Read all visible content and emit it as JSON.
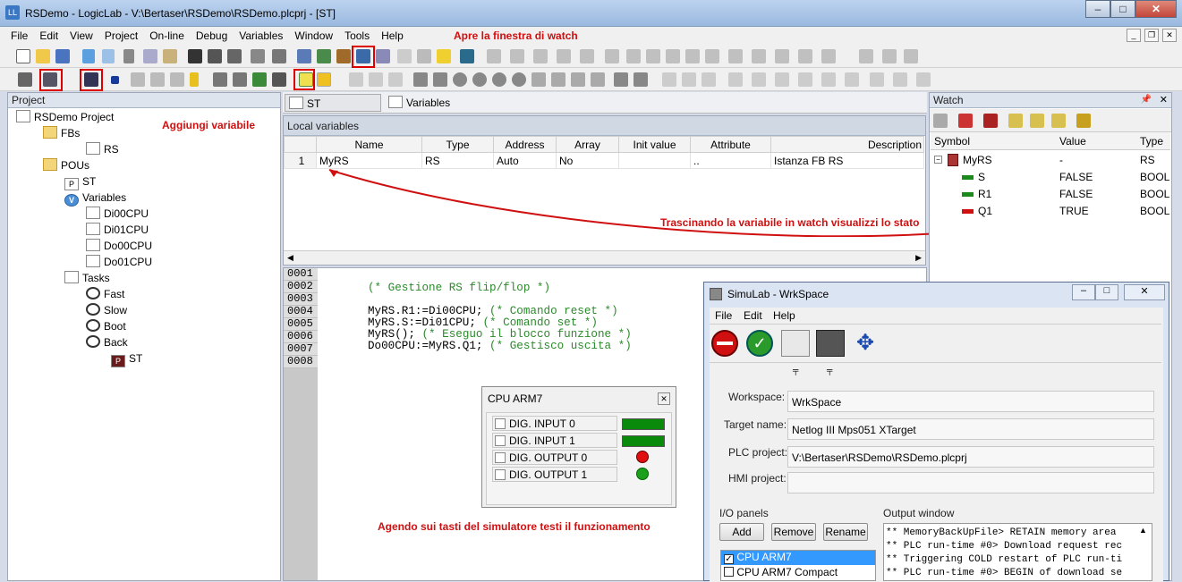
{
  "app": {
    "title": "RSDemo - LogicLab - V:\\Bertaser\\RSDemo\\RSDemo.plcprj - [ST]",
    "icon": "LL"
  },
  "menu": [
    "File",
    "Edit",
    "View",
    "Project",
    "On-line",
    "Debug",
    "Variables",
    "Window",
    "Tools",
    "Help"
  ],
  "annotations": {
    "watch_open": "Apre la finestra di watch",
    "add_variable": "Aggiungi variabile",
    "drag_watch": "Trascinando la variabile in watch visualizzi lo stato",
    "simulator": "Agendo sui tasti del simulatore testi il funzionamento"
  },
  "project_panel": {
    "title": "Project",
    "root": "RSDemo Project",
    "fbs": "FBs",
    "fb_rs": "RS",
    "pous": "POUs",
    "pou_st": "ST",
    "variables": "Variables",
    "vars": [
      "Di00CPU",
      "Di01CPU",
      "Do00CPU",
      "Do01CPU"
    ],
    "tasks": "Tasks",
    "task_list": [
      "Fast",
      "Slow",
      "Boot",
      "Back"
    ],
    "back_st": "ST"
  },
  "editor_tabs": {
    "st": "ST",
    "variables": "Variables"
  },
  "local_vars": {
    "title": "Local variables",
    "headers": [
      "Name",
      "Type",
      "Address",
      "Array",
      "Init value",
      "Attribute",
      "Description"
    ],
    "row": {
      "num": "1",
      "name": "MyRS",
      "type": "RS",
      "address": "Auto",
      "array": "No",
      "init": "",
      "attribute": "..",
      "description": "Istanza FB RS"
    }
  },
  "code": {
    "line_numbers": [
      "0001",
      "0002",
      "0003",
      "0004",
      "0005",
      "0006",
      "0007",
      "0008"
    ],
    "line2": "(* Gestione RS flip/flop *)",
    "l4a": "MyRS.R1:=Di00CPU; ",
    "l4b": "(* Comando reset *)",
    "l5a": "MyRS.S:=Di01CPU; ",
    "l5b": "(* Comando set *)",
    "l6a": "MyRS(); ",
    "l6b": "(* Eseguo il blocco funzione *)",
    "l7a": "Do00CPU:=MyRS.Q1; ",
    "l7b": "(* Gestisco uscita *)"
  },
  "watch": {
    "title": "Watch",
    "headers": [
      "Symbol",
      "Value",
      "Type"
    ],
    "rows": [
      {
        "symbol": "MyRS",
        "value": "-",
        "type": "RS"
      },
      {
        "symbol": "S",
        "value": "FALSE",
        "type": "BOOL"
      },
      {
        "symbol": "R1",
        "value": "FALSE",
        "type": "BOOL"
      },
      {
        "symbol": "Q1",
        "value": "TRUE",
        "type": "BOOL"
      }
    ]
  },
  "cpu_panel": {
    "title": "CPU ARM7",
    "items": [
      "DIG. INPUT 0",
      "DIG. INPUT 1",
      "DIG. OUTPUT 0",
      "DIG. OUTPUT 1"
    ],
    "states": [
      "on",
      "on",
      "red",
      "green"
    ]
  },
  "simulab": {
    "title": "SimuLab - WrkSpace",
    "menu": [
      "File",
      "Edit",
      "Help"
    ],
    "workspace_label": "Workspace:",
    "workspace": "WrkSpace",
    "target_label": "Target name:",
    "target": "Netlog III Mps051 XTarget",
    "plc_label": "PLC project:",
    "plc": "V:\\Bertaser\\RSDemo\\RSDemo.plcprj",
    "hmi_label": "HMI project:",
    "hmi": "",
    "io_label": "I/O panels",
    "output_label": "Output window",
    "add": "Add",
    "remove": "Remove",
    "rename": "Rename",
    "panels": [
      "CPU ARM7",
      "CPU ARM7 Compact"
    ],
    "output": [
      "** MemoryBackUpFile> RETAIN memory area",
      "** PLC run-time #0> Download request rec",
      "** Triggering COLD restart of PLC run-ti",
      "** PLC run-time #0> BEGIN of download se"
    ]
  },
  "colors": {
    "annotation": "#d01010",
    "led_green": "#1aa01a",
    "led_red": "#e01010",
    "bar_green": "#0a8a0a"
  }
}
